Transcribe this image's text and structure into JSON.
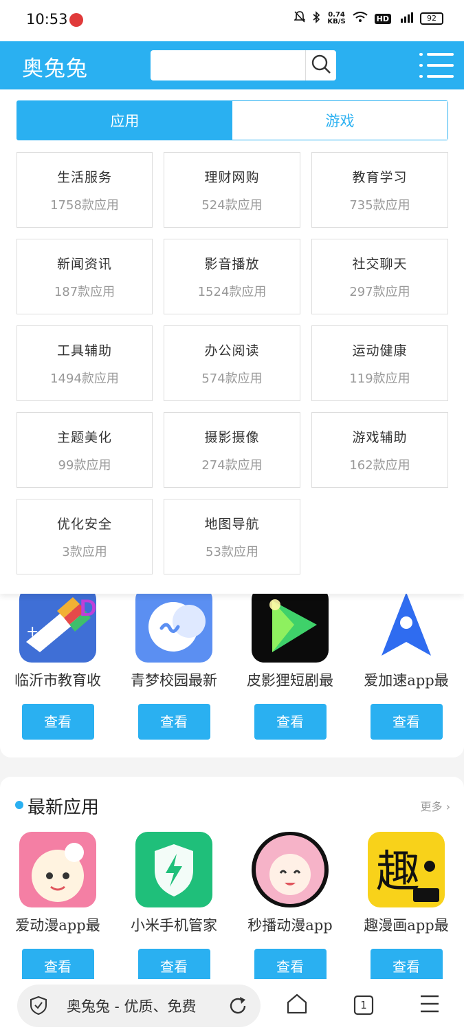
{
  "status_bar": {
    "time": "10:53",
    "net_speed_top": "0.74",
    "net_speed_unit": "KB/S",
    "hd": "HD",
    "signal": "4G",
    "battery": "92"
  },
  "header": {
    "logo": "奥兔兔",
    "search_placeholder": ""
  },
  "tabs": [
    {
      "label": "应用",
      "active": true
    },
    {
      "label": "游戏",
      "active": false
    }
  ],
  "categories": [
    {
      "name": "生活服务",
      "count": "1758款应用"
    },
    {
      "name": "理财网购",
      "count": "524款应用"
    },
    {
      "name": "教育学习",
      "count": "735款应用"
    },
    {
      "name": "新闻资讯",
      "count": "187款应用"
    },
    {
      "name": "影音播放",
      "count": "1524款应用"
    },
    {
      "name": "社交聊天",
      "count": "297款应用"
    },
    {
      "name": "工具辅助",
      "count": "1494款应用"
    },
    {
      "name": "办公阅读",
      "count": "574款应用"
    },
    {
      "name": "运动健康",
      "count": "119款应用"
    },
    {
      "name": "主题美化",
      "count": "99款应用"
    },
    {
      "name": "摄影摄像",
      "count": "274款应用"
    },
    {
      "name": "游戏辅助",
      "count": "162款应用"
    },
    {
      "name": "优化安全",
      "count": "3款应用"
    },
    {
      "name": "地图导航",
      "count": "53款应用"
    }
  ],
  "section_top": {
    "apps": [
      {
        "name": "临沂市教育收",
        "button": "查看"
      },
      {
        "name": "青梦校园最新",
        "button": "查看"
      },
      {
        "name": "皮影狸短剧最",
        "button": "查看"
      },
      {
        "name": "爱加速app最",
        "button": "查看"
      }
    ]
  },
  "section_latest": {
    "title": "最新应用",
    "more": "更多 ›",
    "apps": [
      {
        "name": "爱动漫app最",
        "button": "查看"
      },
      {
        "name": "小米手机管家",
        "button": "查看"
      },
      {
        "name": "秒播动漫app",
        "button": "查看"
      },
      {
        "name": "趣漫画app最",
        "button": "查看"
      }
    ]
  },
  "bottom_bar": {
    "address_text": "奥兔兔 - 优质、免费",
    "tab_count": "1"
  },
  "colors": {
    "accent": "#2ab0f1"
  }
}
